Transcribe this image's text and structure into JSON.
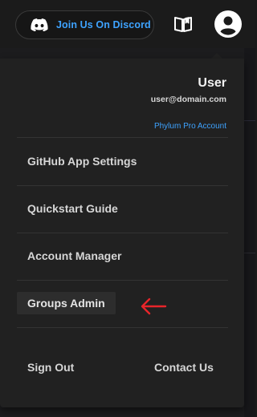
{
  "header": {
    "discord_button_label": "Join Us On Discord",
    "discord_icon": "discord-icon",
    "docs_icon": "book-icon",
    "account_icon": "user-circle-icon"
  },
  "account": {
    "name": "User",
    "email": "user@domain.com",
    "plan": "Phylum Pro Account"
  },
  "menu": {
    "items": [
      {
        "label": "GitHub App Settings"
      },
      {
        "label": "Quickstart Guide"
      },
      {
        "label": "Account Manager"
      },
      {
        "label": "Groups Admin",
        "highlighted": true
      }
    ],
    "sign_out": "Sign Out",
    "contact_us": "Contact Us"
  },
  "annotation": {
    "icon": "red-arrow-icon",
    "color": "#e8252a"
  },
  "colors": {
    "accent": "#3ea3ff",
    "menu_bg": "#212121",
    "page_bg": "#1a1a1a"
  }
}
